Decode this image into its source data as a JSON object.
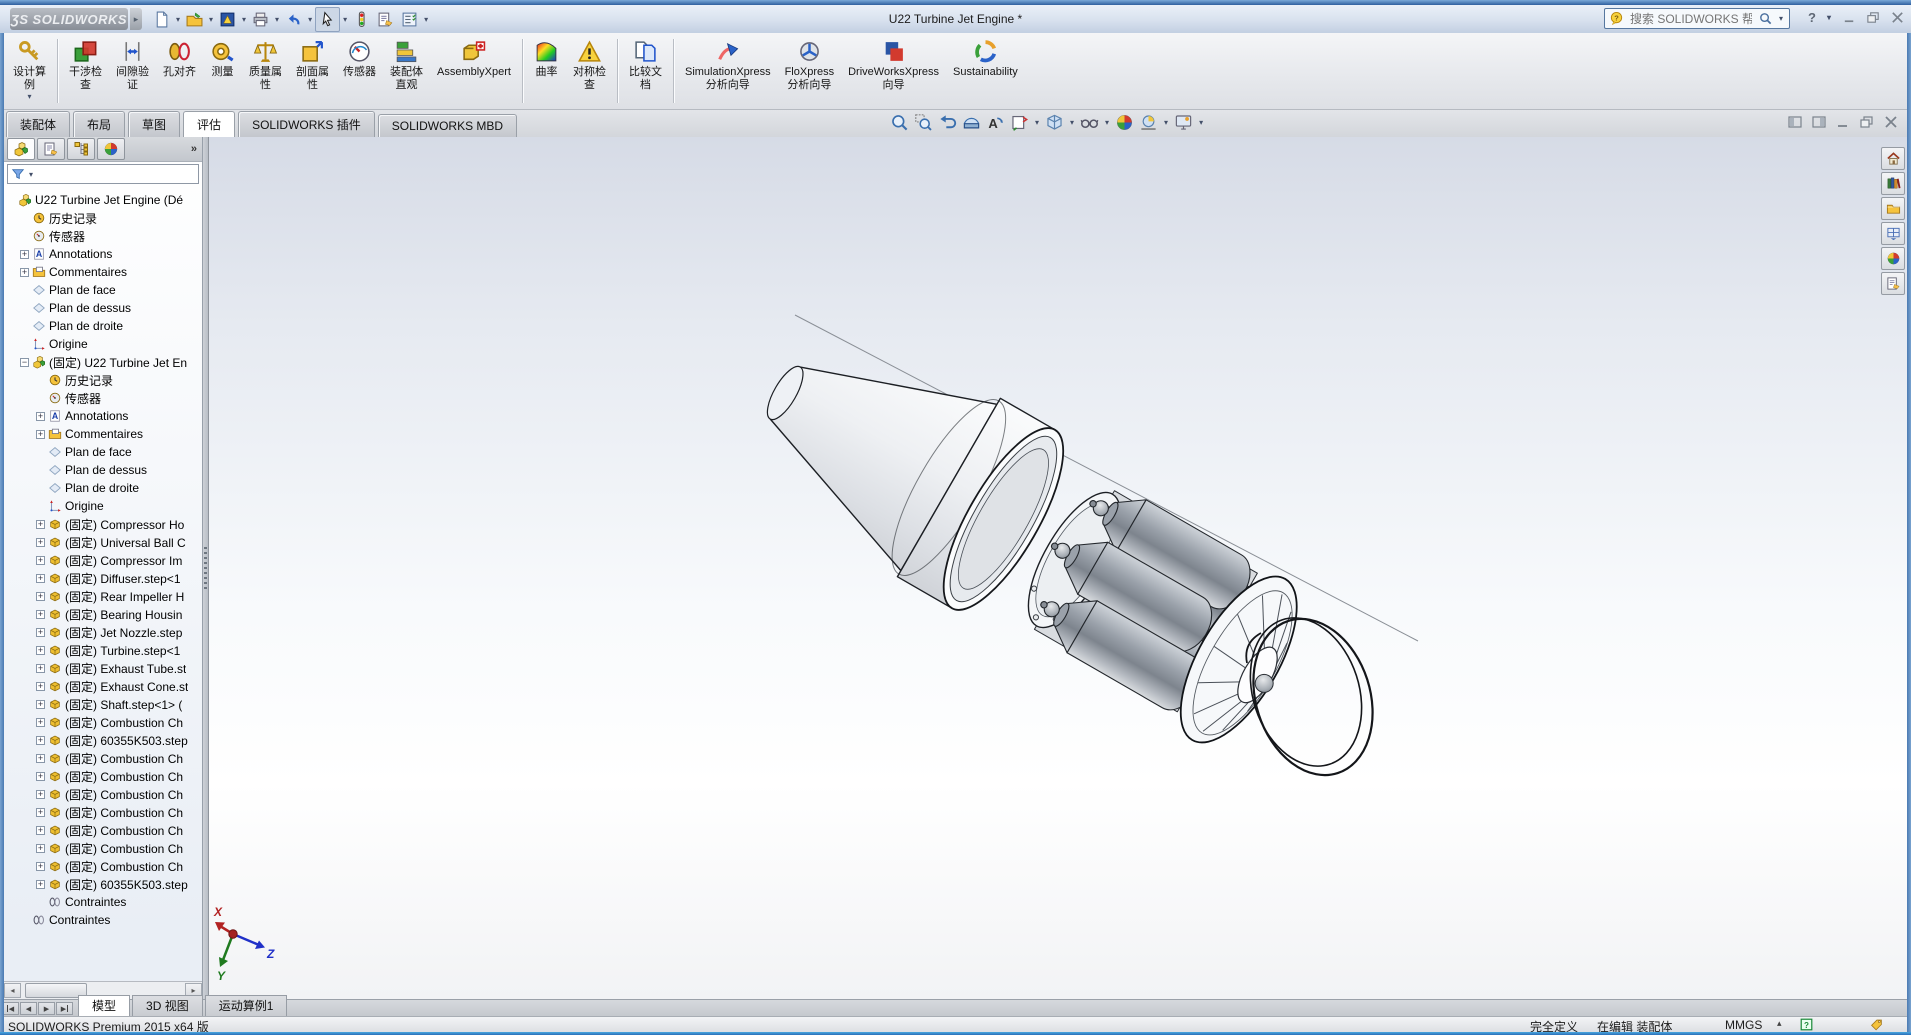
{
  "window": {
    "logo_mark": "ƷS",
    "logo_text": "SOLIDWORKS",
    "title": "U22 Turbine Jet Engine *",
    "search_placeholder": "搜索 SOLIDWORKS 帮助",
    "help_label": "?"
  },
  "glyphs": {
    "dropdown": "▾",
    "chevron": "»",
    "up_small": "▴",
    "left_arrow": "◀",
    "right_arrow": "▶"
  },
  "quick_toolbar": [
    {
      "name": "new-document-button",
      "icon": "new-document",
      "dropdown": true
    },
    {
      "name": "open-button",
      "icon": "open-folder",
      "dropdown": true
    },
    {
      "name": "publish-edrawings-button",
      "icon": "edrawings",
      "dropdown": true
    },
    {
      "name": "print-button",
      "icon": "print",
      "dropdown": true
    },
    {
      "name": "undo-button",
      "icon": "undo",
      "dropdown": true
    },
    {
      "name": "select-button",
      "icon": "select-cursor",
      "dropdown": true,
      "pressed": true
    },
    {
      "name": "selection-filter-button",
      "icon": "selection-filter"
    },
    {
      "name": "properties-button",
      "icon": "properties-form"
    },
    {
      "name": "options-button",
      "icon": "options-list",
      "dropdown": true
    }
  ],
  "ribbon": [
    {
      "name": "design-study-button",
      "icon": "design-study",
      "lines": [
        "设计算",
        "例"
      ],
      "dropdown": true,
      "sep_after": true
    },
    {
      "name": "interference-check-button",
      "icon": "interference",
      "lines": [
        "干涉检",
        "查"
      ]
    },
    {
      "name": "clearance-verify-button",
      "icon": "clearance",
      "lines": [
        "间隙验",
        "证"
      ]
    },
    {
      "name": "hole-alignment-button",
      "icon": "hole-align",
      "lines": [
        "孔对齐"
      ]
    },
    {
      "name": "measure-button",
      "icon": "measure",
      "lines": [
        "测量"
      ]
    },
    {
      "name": "mass-properties-button",
      "icon": "mass-props",
      "lines": [
        "质量属",
        "性"
      ]
    },
    {
      "name": "section-properties-button",
      "icon": "section-props",
      "lines": [
        "剖面属",
        "性"
      ]
    },
    {
      "name": "sensor-button",
      "icon": "sensor",
      "lines": [
        "传感器"
      ]
    },
    {
      "name": "assembly-visualization-button",
      "icon": "assembly-visualize",
      "lines": [
        "装配体",
        "直观"
      ]
    },
    {
      "name": "assemblyxpert-button",
      "icon": "assemblyxpert",
      "lines": [
        "AssemblyXpert"
      ],
      "sep_after": true
    },
    {
      "name": "curvature-button",
      "icon": "curvature",
      "lines": [
        "曲率"
      ]
    },
    {
      "name": "symmetry-check-button",
      "icon": "symmetry-check",
      "lines": [
        "对称检",
        "查"
      ],
      "sep_after": true
    },
    {
      "name": "compare-documents-button",
      "icon": "compare-docs",
      "lines": [
        "比较文",
        "档"
      ],
      "sep_after": true
    },
    {
      "name": "simulationxpress-button",
      "icon": "simulationxpress",
      "lines": [
        "SimulationXpress",
        "分析向导"
      ]
    },
    {
      "name": "floxpress-button",
      "icon": "floxpress",
      "lines": [
        "FloXpress",
        "分析向导"
      ]
    },
    {
      "name": "driveworksxpress-button",
      "icon": "driveworksxpress",
      "lines": [
        "DriveWorksXpress",
        "向导"
      ]
    },
    {
      "name": "sustainability-button",
      "icon": "sustainability",
      "lines": [
        "Sustainability"
      ]
    }
  ],
  "command_tabs": [
    {
      "label": "装配体"
    },
    {
      "label": "布局"
    },
    {
      "label": "草图"
    },
    {
      "label": "评估",
      "active": true
    },
    {
      "label": "SOLIDWORKS 插件"
    },
    {
      "label": "SOLIDWORKS MBD"
    }
  ],
  "headsup": [
    {
      "name": "zoom-to-fit-button",
      "icon": "zoom-fit"
    },
    {
      "name": "zoom-to-area-button",
      "icon": "zoom-area"
    },
    {
      "name": "previous-view-button",
      "icon": "previous-view"
    },
    {
      "name": "section-view-button",
      "icon": "section-view"
    },
    {
      "name": "annotation-views-button",
      "icon": "annotation-views"
    },
    {
      "name": "view-orientation-button",
      "icon": "view-orientation",
      "dropdown": true
    },
    {
      "name": "display-style-button",
      "icon": "display-style",
      "dropdown": true
    },
    {
      "name": "hide-show-items-button",
      "icon": "hide-show",
      "dropdown": true
    },
    {
      "name": "edit-appearance-button",
      "icon": "appearance-sphere"
    },
    {
      "name": "apply-scene-button",
      "icon": "apply-scene",
      "dropdown": true
    },
    {
      "name": "view-settings-button",
      "icon": "view-settings",
      "dropdown": true
    }
  ],
  "fm_tabs": [
    {
      "name": "featuremanager-tab",
      "icon": "assembly",
      "active": true
    },
    {
      "name": "propertymanager-tab",
      "icon": "properties-form"
    },
    {
      "name": "configurationmanager-tab",
      "icon": "config-tree"
    },
    {
      "name": "displaymanager-tab",
      "icon": "appearance-sphere"
    }
  ],
  "feature_tree": {
    "items": [
      {
        "depth": 0,
        "icon": "assembly",
        "label": "U22 Turbine Jet Engine  (Dé",
        "expand": ""
      },
      {
        "depth": 1,
        "icon": "history",
        "label": "历史记录",
        "expand": ""
      },
      {
        "depth": 1,
        "icon": "sensors",
        "label": "传感器",
        "expand": ""
      },
      {
        "depth": 1,
        "icon": "annotations",
        "label": "Annotations",
        "expand": "+"
      },
      {
        "depth": 1,
        "icon": "comments",
        "label": "Commentaires",
        "expand": "+"
      },
      {
        "depth": 1,
        "icon": "plane",
        "label": "Plan de face",
        "expand": ""
      },
      {
        "depth": 1,
        "icon": "plane",
        "label": "Plan de dessus",
        "expand": ""
      },
      {
        "depth": 1,
        "icon": "plane",
        "label": "Plan de droite",
        "expand": ""
      },
      {
        "depth": 1,
        "icon": "orig",
        "label": "Origine",
        "expand": ""
      },
      {
        "depth": 1,
        "icon": "assembly",
        "label": "(固定) U22 Turbine Jet En",
        "expand": "-"
      },
      {
        "depth": 2,
        "icon": "history",
        "label": "历史记录",
        "expand": ""
      },
      {
        "depth": 2,
        "icon": "sensors",
        "label": "传感器",
        "expand": ""
      },
      {
        "depth": 2,
        "icon": "annotations",
        "label": "Annotations",
        "expand": "+"
      },
      {
        "depth": 2,
        "icon": "comments",
        "label": "Commentaires",
        "expand": "+"
      },
      {
        "depth": 2,
        "icon": "plane",
        "label": "Plan de face",
        "expand": ""
      },
      {
        "depth": 2,
        "icon": "plane",
        "label": "Plan de dessus",
        "expand": ""
      },
      {
        "depth": 2,
        "icon": "plane",
        "label": "Plan de droite",
        "expand": ""
      },
      {
        "depth": 2,
        "icon": "orig",
        "label": "Origine",
        "expand": ""
      },
      {
        "depth": 2,
        "icon": "part",
        "label": "(固定) Compressor Ho",
        "expand": "+"
      },
      {
        "depth": 2,
        "icon": "part",
        "label": "(固定) Universal Ball C",
        "expand": "+"
      },
      {
        "depth": 2,
        "icon": "part",
        "label": "(固定) Compressor Im",
        "expand": "+"
      },
      {
        "depth": 2,
        "icon": "part",
        "label": "(固定) Diffuser.step<1",
        "expand": "+"
      },
      {
        "depth": 2,
        "icon": "part",
        "label": "(固定) Rear Impeller H",
        "expand": "+"
      },
      {
        "depth": 2,
        "icon": "part",
        "label": "(固定) Bearing Housin",
        "expand": "+"
      },
      {
        "depth": 2,
        "icon": "part",
        "label": "(固定) Jet Nozzle.step",
        "expand": "+"
      },
      {
        "depth": 2,
        "icon": "part",
        "label": "(固定) Turbine.step<1",
        "expand": "+"
      },
      {
        "depth": 2,
        "icon": "part",
        "label": "(固定) Exhaust Tube.st",
        "expand": "+"
      },
      {
        "depth": 2,
        "icon": "part",
        "label": "(固定) Exhaust Cone.st",
        "expand": "+"
      },
      {
        "depth": 2,
        "icon": "part",
        "label": "(固定) Shaft.step<1> (",
        "expand": "+"
      },
      {
        "depth": 2,
        "icon": "part",
        "label": "(固定) Combustion Ch",
        "expand": "+"
      },
      {
        "depth": 2,
        "icon": "part",
        "label": "(固定) 60355K503.step",
        "expand": "+"
      },
      {
        "depth": 2,
        "icon": "part",
        "label": "(固定) Combustion Ch",
        "expand": "+"
      },
      {
        "depth": 2,
        "icon": "part",
        "label": "(固定) Combustion Ch",
        "expand": "+"
      },
      {
        "depth": 2,
        "icon": "part",
        "label": "(固定) Combustion Ch",
        "expand": "+"
      },
      {
        "depth": 2,
        "icon": "part",
        "label": "(固定) Combustion Ch",
        "expand": "+"
      },
      {
        "depth": 2,
        "icon": "part",
        "label": "(固定) Combustion Ch",
        "expand": "+"
      },
      {
        "depth": 2,
        "icon": "part",
        "label": "(固定) Combustion Ch",
        "expand": "+"
      },
      {
        "depth": 2,
        "icon": "part",
        "label": "(固定) Combustion Ch",
        "expand": "+"
      },
      {
        "depth": 2,
        "icon": "part",
        "label": "(固定) 60355K503.step",
        "expand": "+"
      },
      {
        "depth": 2,
        "icon": "mates",
        "label": "Contraintes",
        "expand": ""
      },
      {
        "depth": 1,
        "icon": "mates",
        "label": "Contraintes",
        "expand": ""
      }
    ]
  },
  "viewport": {
    "triad": {
      "x": "X",
      "y": "Y",
      "z": "Z"
    }
  },
  "model_tabs": {
    "tabs": [
      {
        "label": "模型",
        "active": true
      },
      {
        "label": "3D 视图"
      },
      {
        "label": "运动算例1"
      }
    ]
  },
  "task_pane": [
    {
      "name": "home-tab",
      "icon": "home"
    },
    {
      "name": "design-library-tab",
      "icon": "design-library"
    },
    {
      "name": "file-explorer-tab",
      "icon": "file-explorer"
    },
    {
      "name": "view-palette-tab",
      "icon": "view-palette"
    },
    {
      "name": "appearances-tab",
      "icon": "appearance-sphere"
    },
    {
      "name": "custom-properties-tab",
      "icon": "custom-properties"
    }
  ],
  "status_bar": {
    "product": "SOLIDWORKS Premium 2015 x64 版",
    "define_state": "完全定义",
    "edit_state": "在编辑 装配体",
    "units": "MMGS"
  },
  "colors": {
    "titlebar_blue": "#4f86c2",
    "viewport_top": "#d6dbe6",
    "viewport_bottom": "#ffffff",
    "part_gold": "#f0c63a",
    "bottle_gray": "#9aa1aa",
    "accent_border": "#56779f"
  }
}
